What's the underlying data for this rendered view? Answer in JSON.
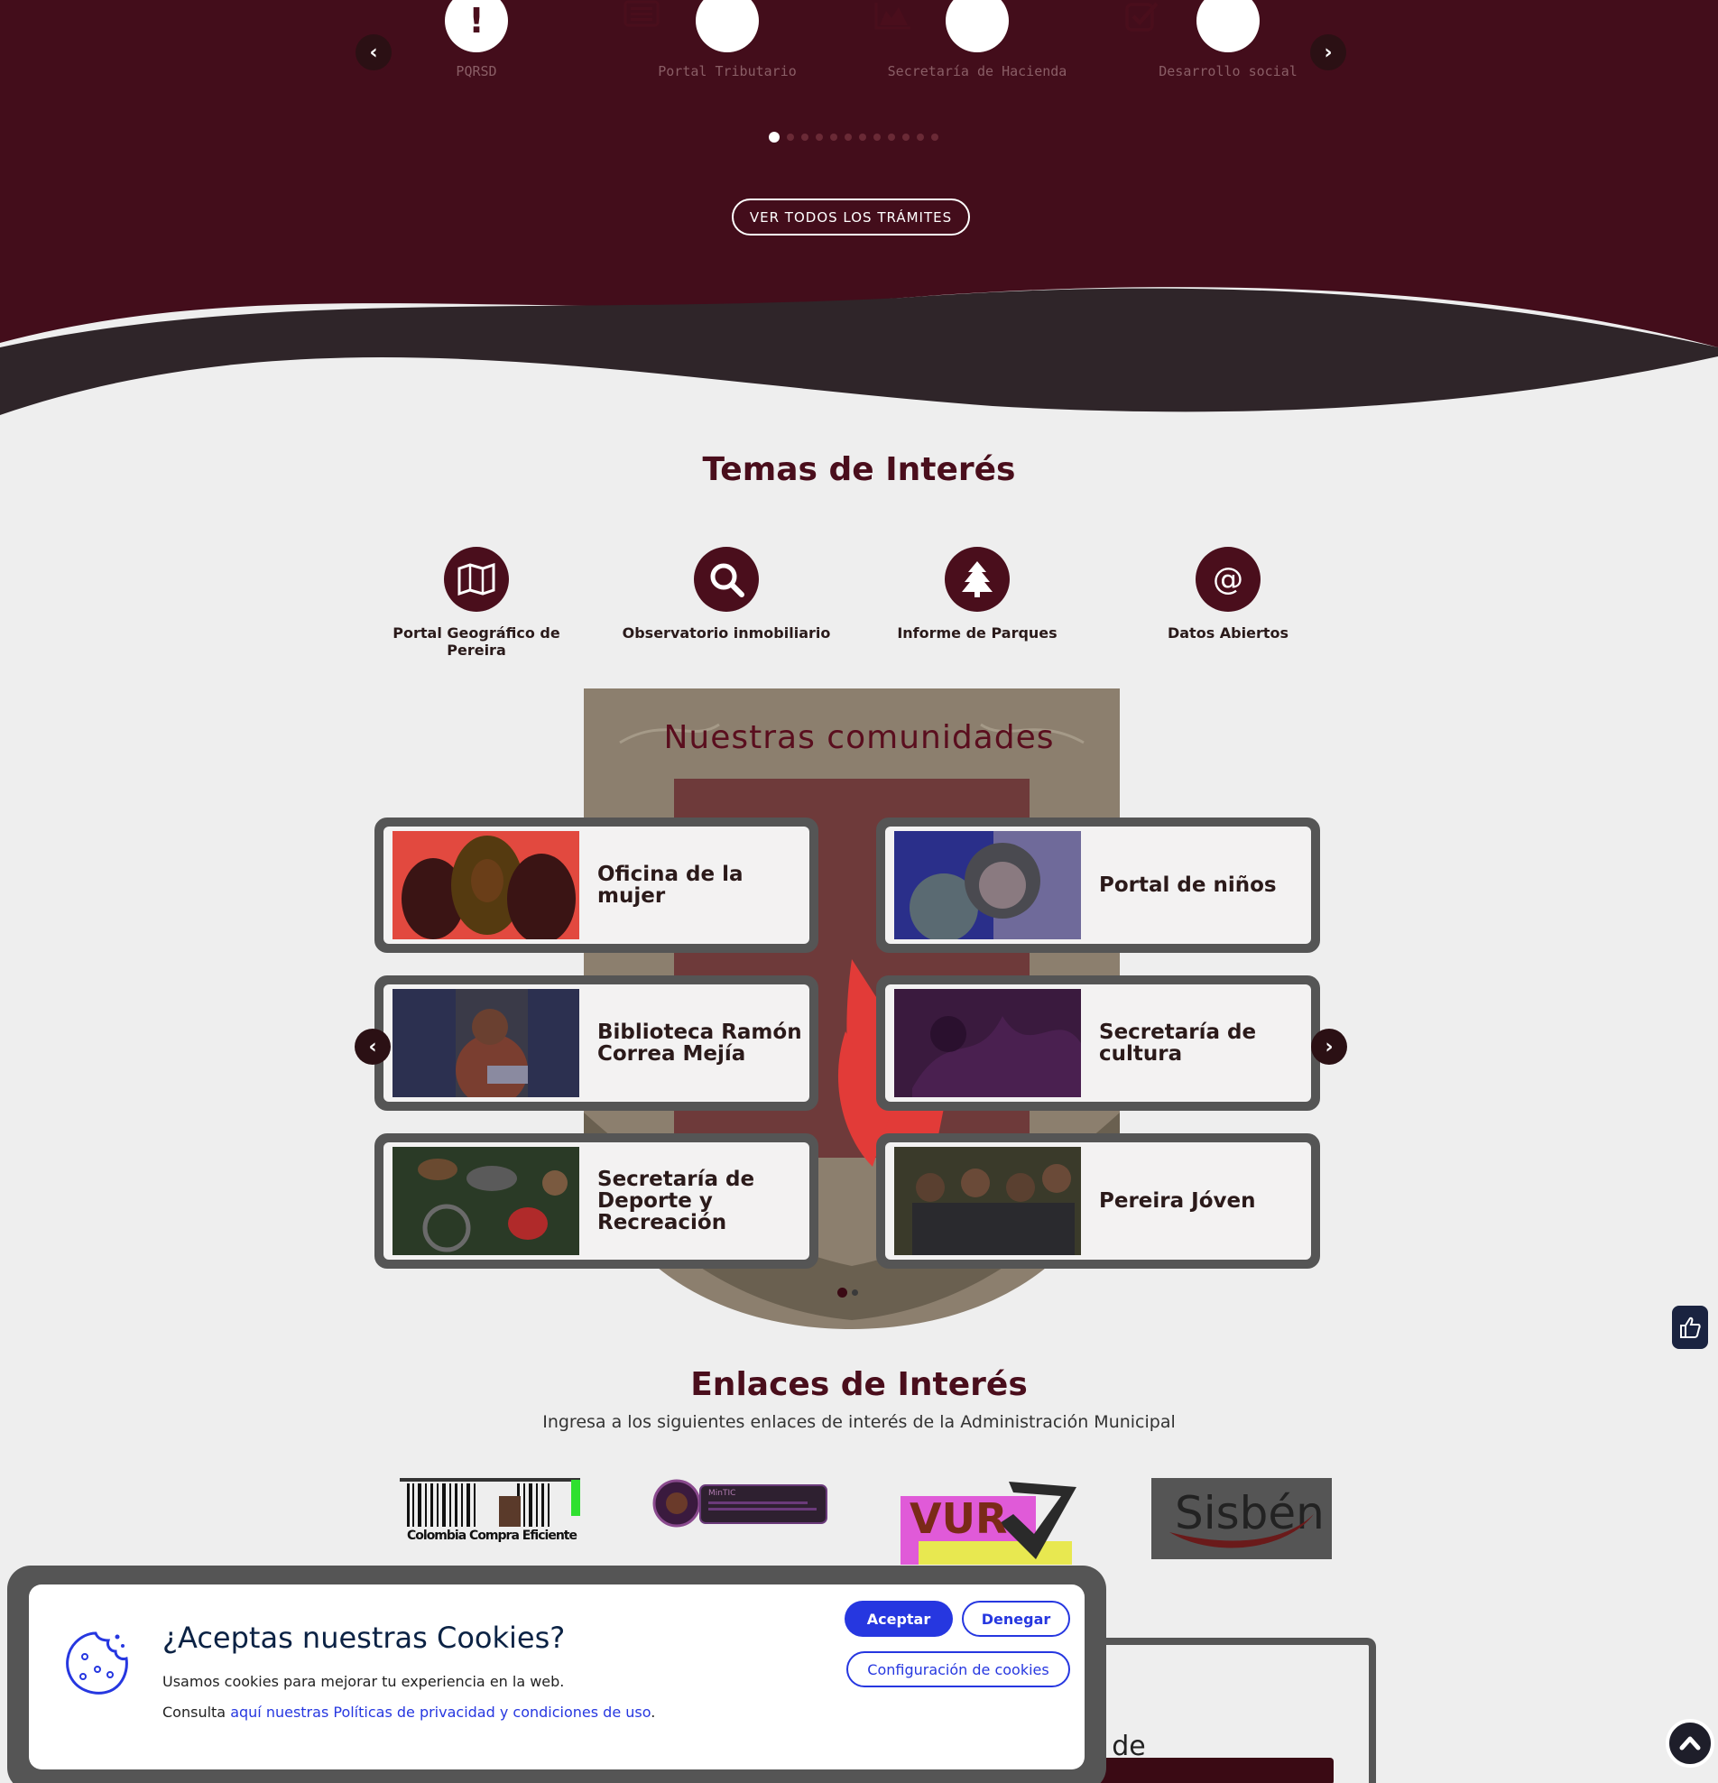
{
  "colors": {
    "brand": "#4a0e1c",
    "accent": "#2637e0",
    "background": "#eeeeee"
  },
  "tramites": {
    "items": [
      {
        "label": "PQRSD",
        "icon": "exclamation-icon"
      },
      {
        "label": "Portal Tributario",
        "icon": "list-icon"
      },
      {
        "label": "Secretaría de Hacienda",
        "icon": "area-chart-icon"
      },
      {
        "label": "Desarrollo social",
        "icon": "checkbox-icon"
      }
    ],
    "button_label": "VER TODOS LOS TRÁMITES",
    "prev_label": "‹",
    "next_label": "›"
  },
  "temas": {
    "title": "Temas de Interés",
    "items": [
      {
        "label": "Portal Geográfico de Pereira",
        "icon": "map-icon"
      },
      {
        "label": "Observatorio inmobiliario",
        "icon": "search-icon"
      },
      {
        "label": "Informe de Parques",
        "icon": "tree-icon"
      },
      {
        "label": "Datos Abiertos",
        "icon": "at-icon"
      }
    ]
  },
  "comunidades": {
    "title": "Nuestras comunidades",
    "cards": [
      {
        "title": "Oficina de la mujer"
      },
      {
        "title": "Portal de niños"
      },
      {
        "title": "Biblioteca Ramón Correa Mejía"
      },
      {
        "title": "Secretaría de cultura"
      },
      {
        "title": "Secretaría de Deporte y Recreación"
      },
      {
        "title": "Pereira Jóven"
      }
    ]
  },
  "enlaces": {
    "title": "Enlaces de Interés",
    "subtitle": "Ingresa a los siguientes enlaces de interés de la Administración Municipal",
    "logos": [
      {
        "name": "Colombia Compra Eficiente"
      },
      {
        "name": "MinTIC"
      },
      {
        "name": "VUR"
      },
      {
        "name": "Sisbén"
      }
    ]
  },
  "cookies": {
    "title": "¿Aceptas nuestras Cookies?",
    "text": "Usamos cookies para mejorar tu experiencia en la web.",
    "consult_prefix": "Consulta ",
    "policy_link": "aquí nuestras Políticas de privacidad y condiciones de uso",
    "consult_suffix": ".",
    "accept": "Aceptar",
    "deny": "Denegar",
    "config": "Configuración de cookies"
  }
}
